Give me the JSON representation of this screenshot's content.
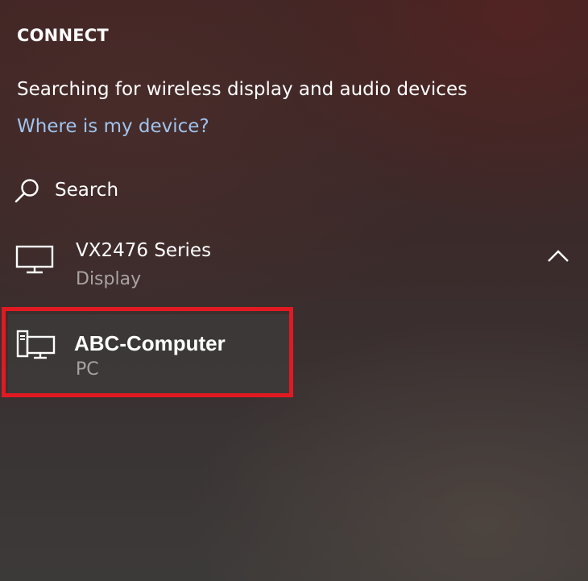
{
  "panel": {
    "title": "CONNECT",
    "status_text": "Searching for wireless display and audio devices",
    "help_link": "Where is my device?"
  },
  "search": {
    "label": "Search",
    "icon": "search-icon"
  },
  "devices": [
    {
      "name": "VX2476 Series",
      "type": "Display",
      "icon": "monitor-icon",
      "expanded": true,
      "chevron_icon": "chevron-up-icon"
    },
    {
      "name": "ABC-Computer",
      "type": "PC",
      "icon": "pc-icon",
      "highlighted": true
    }
  ],
  "colors": {
    "link": "#9fc3ee",
    "highlight_border": "#e11a22",
    "secondary_text": "#a8a3a2",
    "text": "#ffffff"
  }
}
